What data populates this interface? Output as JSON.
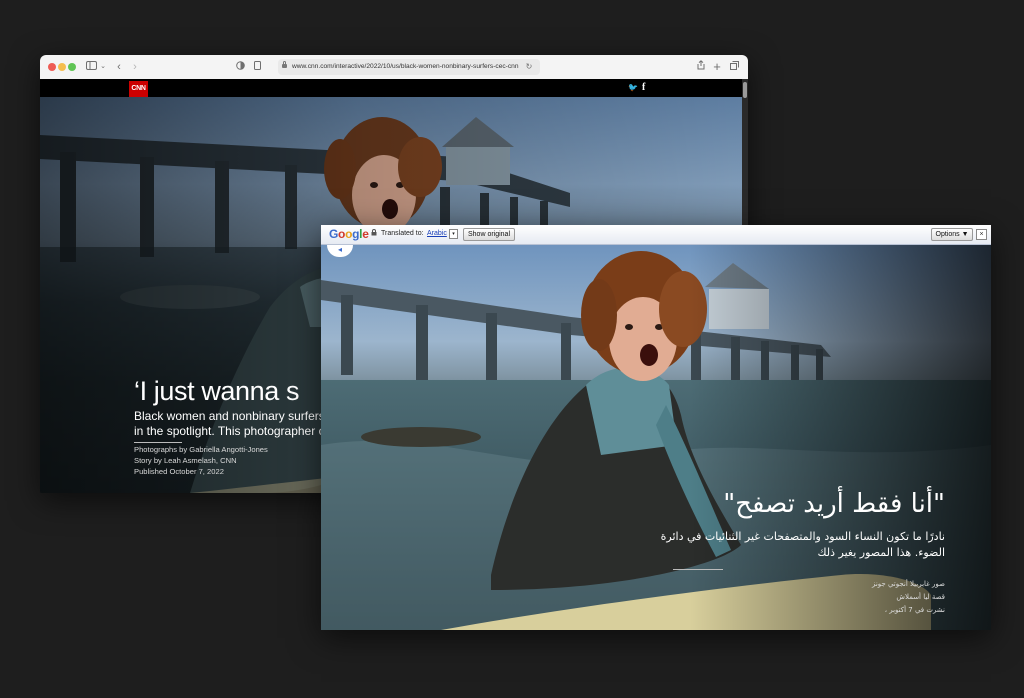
{
  "back_window": {
    "browser": {
      "url": "www.cnn.com/interactive/2022/10/us/black-women-nonbinary-surfers-cec-cnn"
    },
    "site": {
      "logo": "CNN",
      "twitter_glyph": "🐦",
      "facebook_glyph": "f"
    },
    "article": {
      "title": "‘I just wanna s",
      "subtitle": "Black women and nonbinary surfers in the spotlight. This photographer c",
      "photo_credit": "Photographs by Gabriella Angotti-Jones",
      "story_credit": "Story by Leah Asmelash, CNN",
      "published": "Published October 7, 2022"
    }
  },
  "front_window": {
    "translate_bar": {
      "logo_letters": [
        "G",
        "o",
        "o",
        "g",
        "l",
        "e"
      ],
      "logo_colors": [
        "#3b6bcc",
        "#d0392b",
        "#e9a21a",
        "#3b6bcc",
        "#2f9e44",
        "#d0392b"
      ],
      "translated_to_label": "Translated to:",
      "language": "Arabic",
      "language_dropdown": "▾",
      "show_original_label": "Show original",
      "options_label": "Options ▼",
      "close_label": "×"
    },
    "article": {
      "title": "\"أنا فقط أريد تصفح\"",
      "subtitle": "نادرًا ما تكون النساء السود والمتصفحات غير الثنائيات في دائرة الضوء. هذا المصور يغير ذلك",
      "photo_credit": "صور غابرييلا أنجوتي جونز",
      "story_credit": "قصة ليا أسملاش",
      "published": "نشرت في 7 أكتوبر ،"
    }
  }
}
